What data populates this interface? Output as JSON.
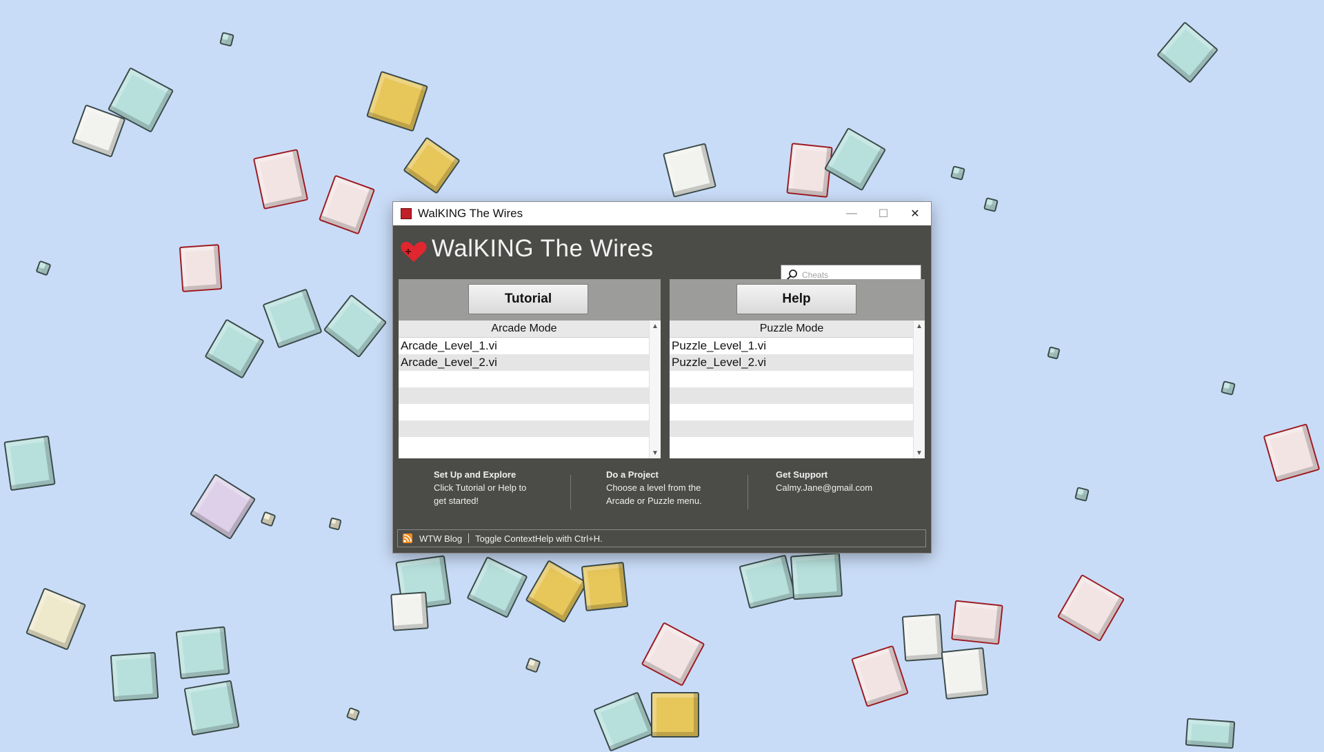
{
  "window": {
    "title": "WalKING The Wires",
    "minimize_glyph": "—",
    "maximize_glyph": "☐",
    "close_glyph": "✕"
  },
  "header": {
    "app_name": "WalKING The Wires",
    "search_placeholder": "Cheats",
    "search_value": ""
  },
  "arcade": {
    "button_label": "Tutorial",
    "list_header": "Arcade Mode",
    "items": [
      "Arcade_Level_1.vi",
      "Arcade_Level_2.vi"
    ]
  },
  "puzzle": {
    "button_label": "Help",
    "list_header": "Puzzle Mode",
    "items": [
      "Puzzle_Level_1.vi",
      "Puzzle_Level_2.vi"
    ]
  },
  "info": {
    "setup": {
      "heading": "Set Up and Explore",
      "line1": "Click Tutorial or Help to",
      "line2": "get started!"
    },
    "project": {
      "heading": "Do a Project",
      "line1": "Choose a level from the",
      "line2": "Arcade or Puzzle menu."
    },
    "support": {
      "heading": "Get Support",
      "line1": "Calmy.Jane@gmail.com"
    }
  },
  "statusbar": {
    "blog_label": "WTW Blog",
    "hint": "Toggle ContextHelp with Ctrl+H."
  },
  "colors": {
    "background": "#c9dcf7",
    "window_body": "#4b4b48",
    "brand_red": "#e0262e"
  },
  "icons": [
    "app-icon",
    "heart-logo-icon",
    "search-icon",
    "rss-icon",
    "scroll-up-icon",
    "scroll-down-icon"
  ]
}
